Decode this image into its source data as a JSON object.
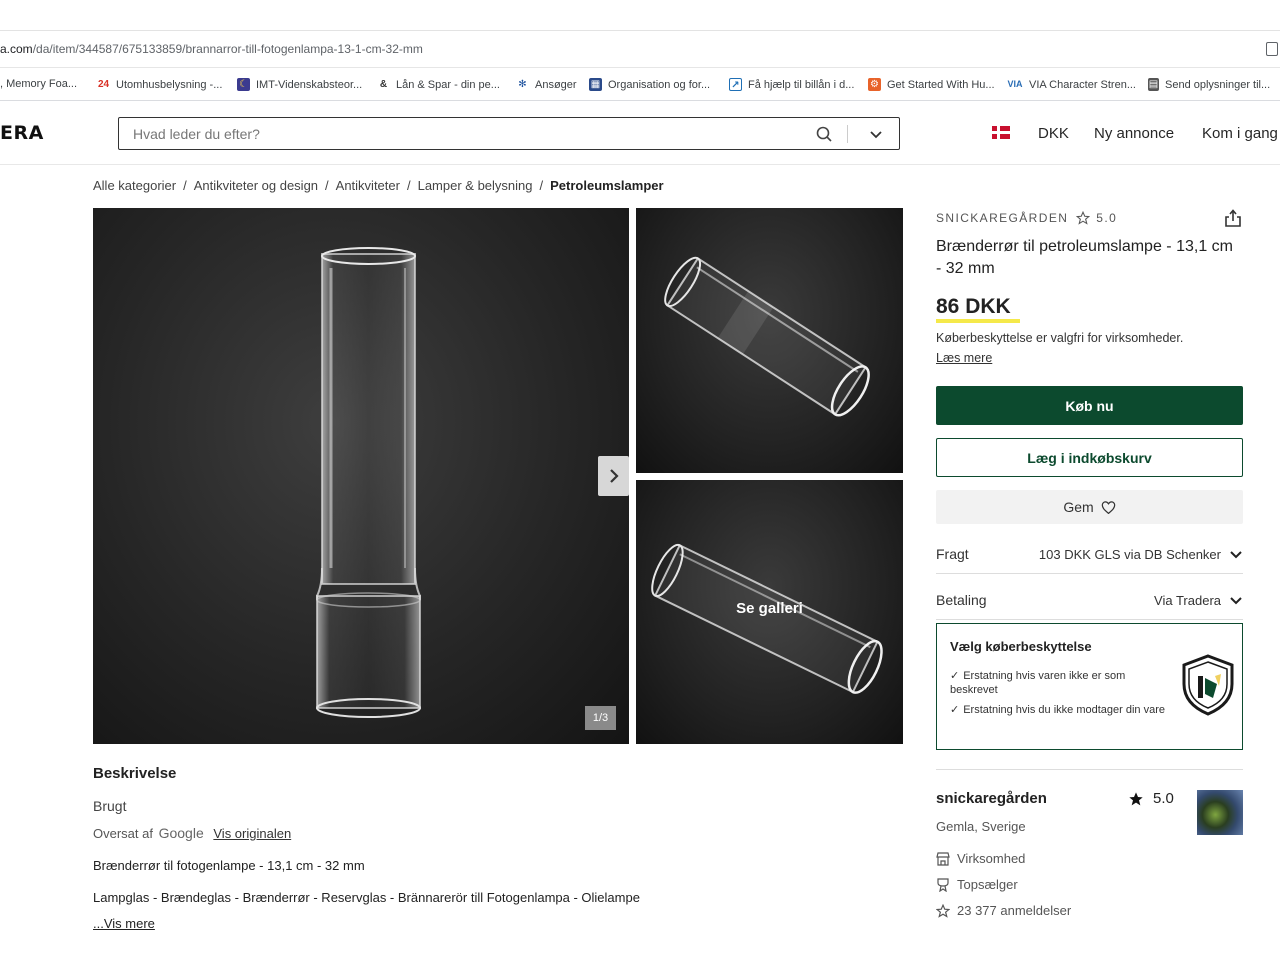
{
  "browser": {
    "url_domain": "a.com",
    "url_path": "/da/item/344587/675133859/brannarror-till-fotogenlampa-13-1-cm-32-mm",
    "bookmarks": [
      {
        "label": ", Memory Foa...",
        "icon": "memory-foam-favicon",
        "color": "#999999"
      },
      {
        "label": "Utomhusbelysning -...",
        "icon": "24-favicon",
        "color": "#d93025"
      },
      {
        "label": "IMT-Videnskabsteor...",
        "icon": "moon-favicon",
        "color": "#3b3b8f"
      },
      {
        "label": "Lån & Spar - din pe...",
        "icon": "ampersand-favicon",
        "color": "#333333"
      },
      {
        "label": "Ansøger",
        "icon": "gear-favicon",
        "color": "#1a4f9c"
      },
      {
        "label": "Organisation og for...",
        "icon": "grid-favicon",
        "color": "#2a4a8a"
      },
      {
        "label": "Få hjælp til billån i d...",
        "icon": "chart-favicon",
        "color": "#1f6fb5"
      },
      {
        "label": "Get Started With Hu...",
        "icon": "hubspot-favicon",
        "color": "#e8632a"
      },
      {
        "label": "VIA Character Stren...",
        "icon": "via-favicon",
        "color": "#2a6db5"
      },
      {
        "label": "Send oplysninger til...",
        "icon": "doc-favicon",
        "color": "#555555"
      }
    ]
  },
  "header": {
    "logo": "ERA",
    "search_placeholder": "Hvad leder du efter?",
    "currency": "DKK",
    "new_listing": "Ny annonce",
    "get_started": "Kom i gang"
  },
  "breadcrumb": [
    "Alle kategorier",
    "Antikviteter og design",
    "Antikviteter",
    "Lamper & belysning",
    "Petroleumslamper"
  ],
  "gallery": {
    "counter": "1/3",
    "see_gallery": "Se galleri"
  },
  "description": {
    "title": "Beskrivelse",
    "condition": "Brugt",
    "translated_by": "Oversat af",
    "google": "Google",
    "show_original": "Vis originalen",
    "line1": "Brænderrør til fotogenlampe - 13,1 cm - 32 mm",
    "line2": "Lampglas - Brændeglas - Brænderrør - Reservglas - Brännarerör till Fotogenlampa - Olielampe",
    "show_more": "...Vis mere"
  },
  "listing": {
    "seller_upper": "SNICKAREGÅRDEN",
    "rating": "5.0",
    "title": "Brænderrør til petroleumslampe - 13,1 cm - 32 mm",
    "price": "86 DKK",
    "buyer_protection_note": "Køberbeskyttelse er valgfri for virksomheder.",
    "read_more": "Læs mere",
    "buy_now": "Køb nu",
    "add_to_cart": "Læg i indkøbskurv",
    "save": "Gem",
    "shipping_label": "Fragt",
    "shipping_value": "103 DKK GLS via DB Schenker",
    "payment_label": "Betaling",
    "payment_value": "Via Tradera",
    "protection": {
      "title": "Vælg køberbeskyttelse",
      "item1": "Erstatning hvis varen ikke er som beskrevet",
      "item2": "Erstatning hvis du ikke modtager din vare"
    }
  },
  "seller": {
    "name": "snickaregården",
    "rating": "5.0",
    "location": "Gemla, Sverige",
    "type": "Virksomhed",
    "badge": "Topsælger",
    "reviews": "23 377 anmeldelser"
  },
  "colors": {
    "primary_green": "#0c4a2e",
    "price_highlight": "#f5e94a",
    "flag_red": "#c8102e"
  }
}
